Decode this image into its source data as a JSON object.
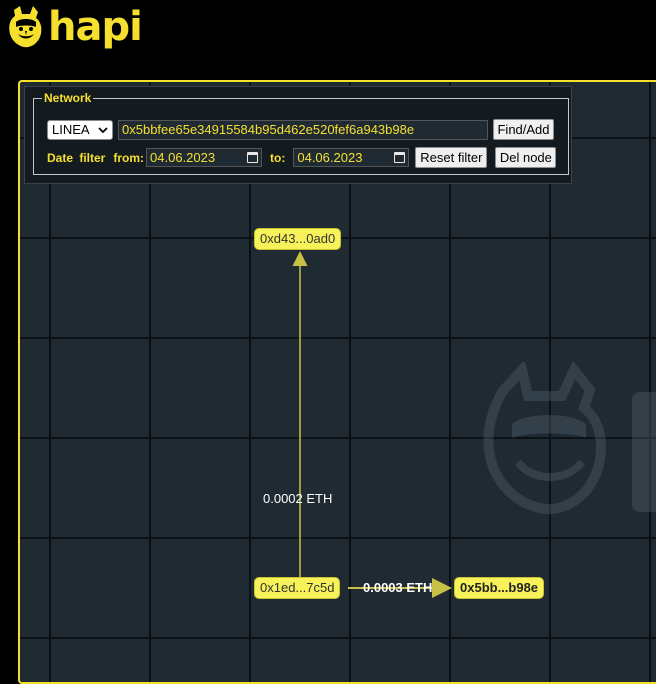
{
  "brand": {
    "name": "hapi",
    "accent_color": "#f5e02e",
    "logo_icon": "hapi-mascot-icon"
  },
  "control_panel": {
    "legend": "Network",
    "network_select": {
      "value": "LINEA",
      "icon": "chevron-down-icon"
    },
    "address_input": {
      "value": "0x5bbfee65e34915584b95d462e520fef6a943b98e"
    },
    "find_add_label": "Find/Add",
    "date_filter_label": "Date filter",
    "from_label": "from:",
    "from_date": "04.06.2023",
    "to_label": "to:",
    "to_date": "04.06.2023",
    "calendar_icon": "calendar-icon",
    "reset_filter_label": "Reset filter",
    "del_node_label": "Del node"
  },
  "graph": {
    "nodes": [
      {
        "id": "top",
        "label": "0xd43...0ad0"
      },
      {
        "id": "source",
        "label": "0x1ed...7c5d"
      },
      {
        "id": "main",
        "label": "0x5bb...b98e"
      }
    ],
    "edges": [
      {
        "from": "source",
        "to": "top",
        "label": "0.0002 ETH"
      },
      {
        "from": "source",
        "to": "main",
        "label": "0.0003 ETH"
      }
    ],
    "edge_color": "#c7c246",
    "background_color": "#1f2a33"
  }
}
